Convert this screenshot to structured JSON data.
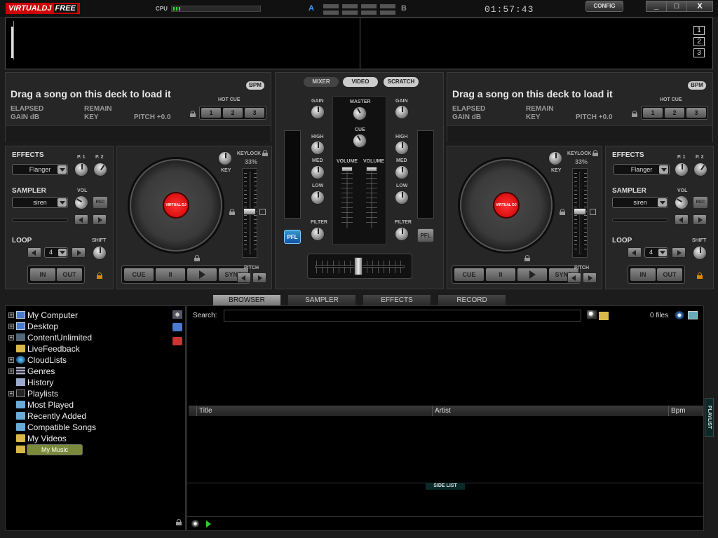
{
  "app": {
    "logo_main": "VIRTUALDJ",
    "logo_free": "FREE",
    "cpu_label": "CPU",
    "cpu_load": 0.1,
    "deck_a_label": "A",
    "deck_b_label": "B",
    "clock": "01:57:43",
    "config_label": "CONFIG",
    "minimize": "_",
    "maximize": "□",
    "close": "X",
    "colors": {
      "accent_a": "#3aa0ff",
      "logo": "#cc0000",
      "selected": "#7a8a3a"
    }
  },
  "waveform": {
    "zoom_buttons": [
      "1",
      "2",
      "3"
    ]
  },
  "deck_left": {
    "message": "Drag a song on this deck to load it",
    "elapsed_label": "ELAPSED",
    "remain_label": "REMAIN",
    "gain_label": "GAIN dB",
    "key_label": "KEY",
    "pitch_label": "PITCH +0.0",
    "bpm_label": "BPM",
    "hot_cue_label": "HOT CUE",
    "hot_cues": [
      "1",
      "2",
      "3"
    ],
    "effects_label": "EFFECTS",
    "effect_value": "Flanger",
    "p1_label": "P. 1",
    "p2_label": "P. 2",
    "sampler_label": "SAMPLER",
    "sampler_value": "siren",
    "vol_label": "VOL",
    "rec_label": "REC",
    "loop_label": "LOOP",
    "loop_value": "4",
    "shift_label": "SHIFT",
    "in_label": "IN",
    "out_label": "OUT",
    "keylock_label": "KEYLOCK",
    "keylock_pct": "33%",
    "key_knob_label": "KEY",
    "disc_label": "VIRTUAL DJ",
    "cue_label": "CUE",
    "pause_label": "II",
    "sync_label": "SYNC",
    "pitch_bend_label": "PITCH"
  },
  "deck_right": {
    "message": "Drag a song on this deck to load it",
    "elapsed_label": "ELAPSED",
    "remain_label": "REMAIN",
    "gain_label": "GAIN dB",
    "key_label": "KEY",
    "pitch_label": "PITCH +0.0",
    "bpm_label": "BPM",
    "hot_cue_label": "HOT CUE",
    "hot_cues": [
      "1",
      "2",
      "3"
    ],
    "effects_label": "EFFECTS",
    "effect_value": "Flanger",
    "p1_label": "P. 1",
    "p2_label": "P. 2",
    "sampler_label": "SAMPLER",
    "sampler_value": "siren",
    "vol_label": "VOL",
    "rec_label": "REC",
    "loop_label": "LOOP",
    "loop_value": "4",
    "shift_label": "SHIFT",
    "in_label": "IN",
    "out_label": "OUT",
    "keylock_label": "KEYLOCK",
    "keylock_pct": "33%",
    "key_knob_label": "KEY",
    "disc_label": "VIRTUAL DJ",
    "cue_label": "CUE",
    "pause_label": "II",
    "sync_label": "SYNC",
    "pitch_bend_label": "PITCH"
  },
  "mixer": {
    "tabs": [
      "MIXER",
      "VIDEO",
      "SCRATCH"
    ],
    "gain_label": "GAIN",
    "master_label": "MASTER",
    "cue_label": "CUE",
    "high_label": "HIGH",
    "med_label": "MED",
    "low_label": "LOW",
    "filter_label": "FILTER",
    "volume_label": "VOLUME",
    "pfl_label": "PFL"
  },
  "browser": {
    "tabs": [
      "BROWSER",
      "SAMPLER",
      "EFFECTS",
      "RECORD"
    ],
    "search_label": "Search:",
    "search_value": "",
    "files_count": "0 files",
    "columns": [
      "Title",
      "Artist",
      "Bpm"
    ],
    "side_list_label": "SIDE LIST",
    "playlist_label": "PLAYLIST",
    "tree": [
      {
        "label": "My Computer",
        "icon": "computer-icon",
        "expandable": true
      },
      {
        "label": "Desktop",
        "icon": "desktop-icon",
        "expandable": true
      },
      {
        "label": "ContentUnlimited",
        "icon": "content-unlimited-icon",
        "expandable": true
      },
      {
        "label": "LiveFeedback",
        "icon": "folder-icon",
        "expandable": false
      },
      {
        "label": "CloudLists",
        "icon": "globe-icon",
        "expandable": true
      },
      {
        "label": "Genres",
        "icon": "genres-icon",
        "expandable": true
      },
      {
        "label": "History",
        "icon": "history-icon",
        "expandable": false
      },
      {
        "label": "Playlists",
        "icon": "playlists-icon",
        "expandable": true
      },
      {
        "label": "Most Played",
        "icon": "smart-folder-icon",
        "expandable": false
      },
      {
        "label": "Recently Added",
        "icon": "smart-folder-icon",
        "expandable": false
      },
      {
        "label": "Compatible Songs",
        "icon": "smart-folder-icon",
        "expandable": false
      },
      {
        "label": "My Videos",
        "icon": "folder-icon",
        "expandable": false
      },
      {
        "label": "My Music",
        "icon": "folder-icon",
        "expandable": false,
        "selected": true
      }
    ]
  }
}
